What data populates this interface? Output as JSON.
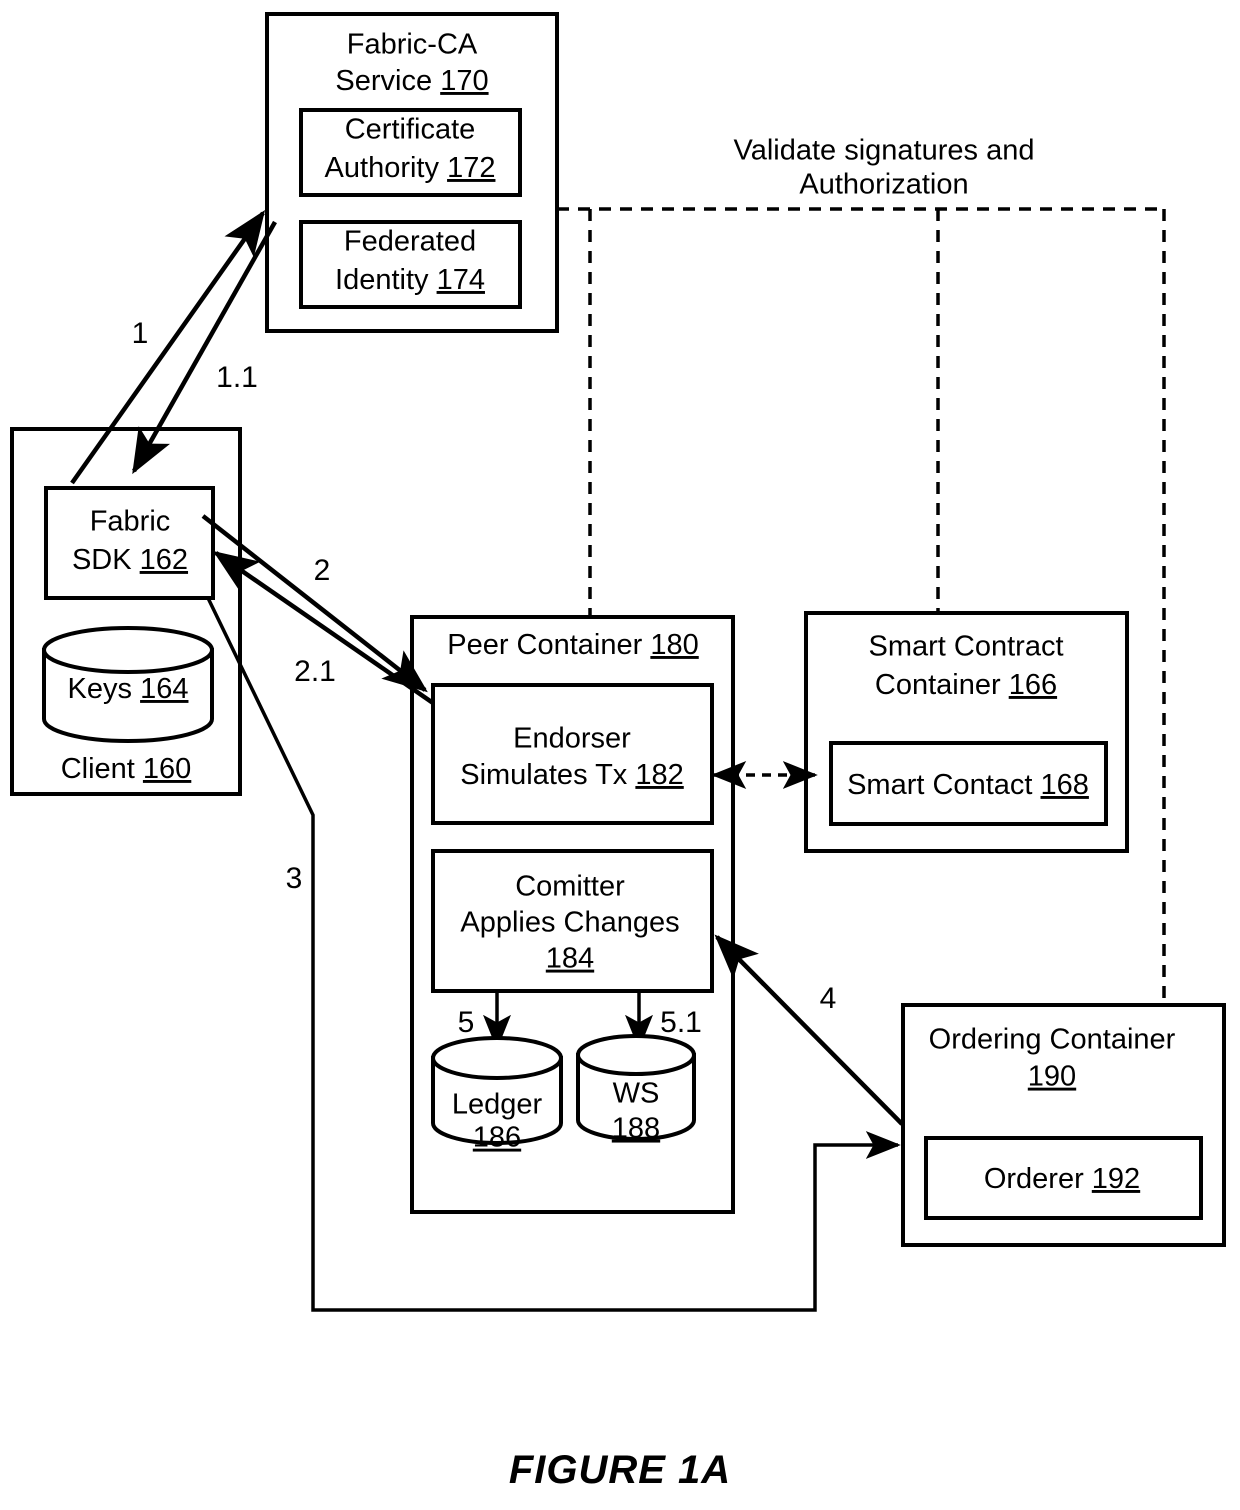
{
  "figure": {
    "caption": "FIGURE 1A"
  },
  "annotations": {
    "validate_line1": "Validate signatures and",
    "validate_line2": "Authorization"
  },
  "nodes": {
    "fabric_ca": {
      "title_line1": "Fabric-CA",
      "title_line2": "Service",
      "ref": "170",
      "children": [
        {
          "line1": "Certificate",
          "line2": "Authority",
          "ref": "172"
        },
        {
          "line1": "Federated",
          "line2": "Identity",
          "ref": "174"
        }
      ]
    },
    "client": {
      "title": "Client",
      "ref": "160",
      "sdk": {
        "line1": "Fabric",
        "line2": "SDK",
        "ref": "162"
      },
      "keys": {
        "label": "Keys",
        "ref": "164"
      }
    },
    "peer_container": {
      "title": "Peer Container",
      "ref": "180",
      "endorser": {
        "line1": "Endorser",
        "line2": "Simulates Tx",
        "ref": "182"
      },
      "committer": {
        "line1": "Comitter",
        "line2": "Applies Changes",
        "ref": "184"
      },
      "ledger": {
        "label": "Ledger",
        "ref": "186"
      },
      "ws": {
        "label": "WS",
        "ref": "188"
      }
    },
    "smart_contract_container": {
      "title_line1": "Smart Contract",
      "title_line2": "Container",
      "ref": "166",
      "inner": {
        "label": "Smart Contact",
        "ref": "168"
      }
    },
    "ordering_container": {
      "title": "Ordering Container",
      "ref": "190",
      "inner": {
        "label": "Orderer",
        "ref": "192"
      }
    }
  },
  "flow_labels": {
    "step1": "1",
    "step1_1": "1.1",
    "step2": "2",
    "step2_1": "2.1",
    "step3": "3",
    "step4": "4",
    "step5": "5",
    "step5_1": "5.1"
  },
  "colors": {
    "stroke": "#000000",
    "fill": "#ffffff"
  }
}
